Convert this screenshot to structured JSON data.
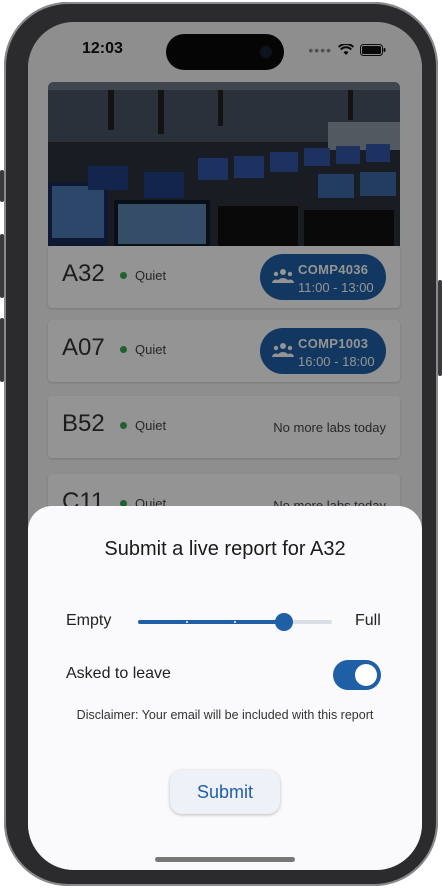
{
  "status_bar": {
    "time": "12:03"
  },
  "rooms": [
    {
      "name": "A32",
      "status": "Quiet",
      "next": {
        "code": "COMP4036",
        "time": "11:00 - 13:00"
      }
    },
    {
      "name": "A07",
      "status": "Quiet",
      "next": {
        "code": "COMP1003",
        "time": "16:00 - 18:00"
      }
    },
    {
      "name": "B52",
      "status": "Quiet",
      "note": "No more labs today"
    },
    {
      "name": "C11",
      "status": "Quiet",
      "note": "No more labs today"
    }
  ],
  "sheet": {
    "title": "Submit a live report for A32",
    "slider": {
      "min_label": "Empty",
      "max_label": "Full",
      "value": 0.75,
      "steps": 4
    },
    "asked_to_leave": {
      "label": "Asked to leave",
      "on": true
    },
    "disclaimer": "Disclaimer: Your email will be included with this report",
    "submit_label": "Submit"
  },
  "colors": {
    "accent": "#1f5fa6",
    "quiet": "#3aa655"
  }
}
